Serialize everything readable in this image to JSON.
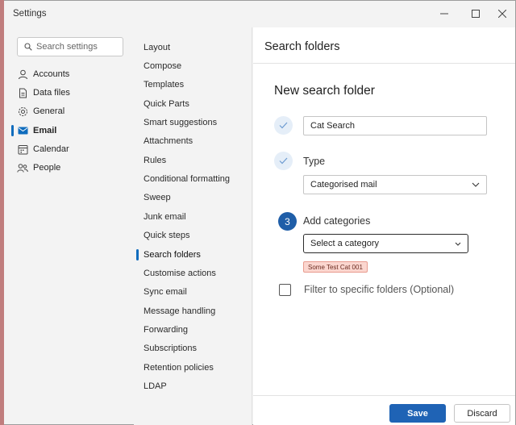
{
  "window": {
    "title": "Settings"
  },
  "nav": {
    "search_placeholder": "Search settings",
    "items": [
      {
        "label": "Accounts",
        "icon": "person-icon"
      },
      {
        "label": "Data files",
        "icon": "document-icon"
      },
      {
        "label": "General",
        "icon": "gear-icon"
      },
      {
        "label": "Email",
        "icon": "mail-icon"
      },
      {
        "label": "Calendar",
        "icon": "calendar-icon"
      },
      {
        "label": "People",
        "icon": "people-icon"
      }
    ],
    "selected": "Email"
  },
  "email_settings": {
    "items": [
      "Layout",
      "Compose",
      "Templates",
      "Quick Parts",
      "Smart suggestions",
      "Attachments",
      "Rules",
      "Conditional formatting",
      "Sweep",
      "Junk email",
      "Quick steps",
      "Search folders",
      "Customise actions",
      "Sync email",
      "Message handling",
      "Forwarding",
      "Subscriptions",
      "Retention policies",
      "LDAP"
    ],
    "selected": "Search folders"
  },
  "panel": {
    "title": "Search folders",
    "subtitle": "New search folder",
    "name_value": "Cat Search",
    "type_label": "Type",
    "type_value": "Categorised mail",
    "step3_number": "3",
    "categories_label": "Add categories",
    "category_placeholder": "Select a category",
    "category_tag": "Some Test Cat 001",
    "filter_label": "Filter to specific folders (Optional)",
    "save_label": "Save",
    "discard_label": "Discard"
  },
  "colors": {
    "accent": "#1f63b5",
    "tag_bg": "#fbd6cf"
  }
}
